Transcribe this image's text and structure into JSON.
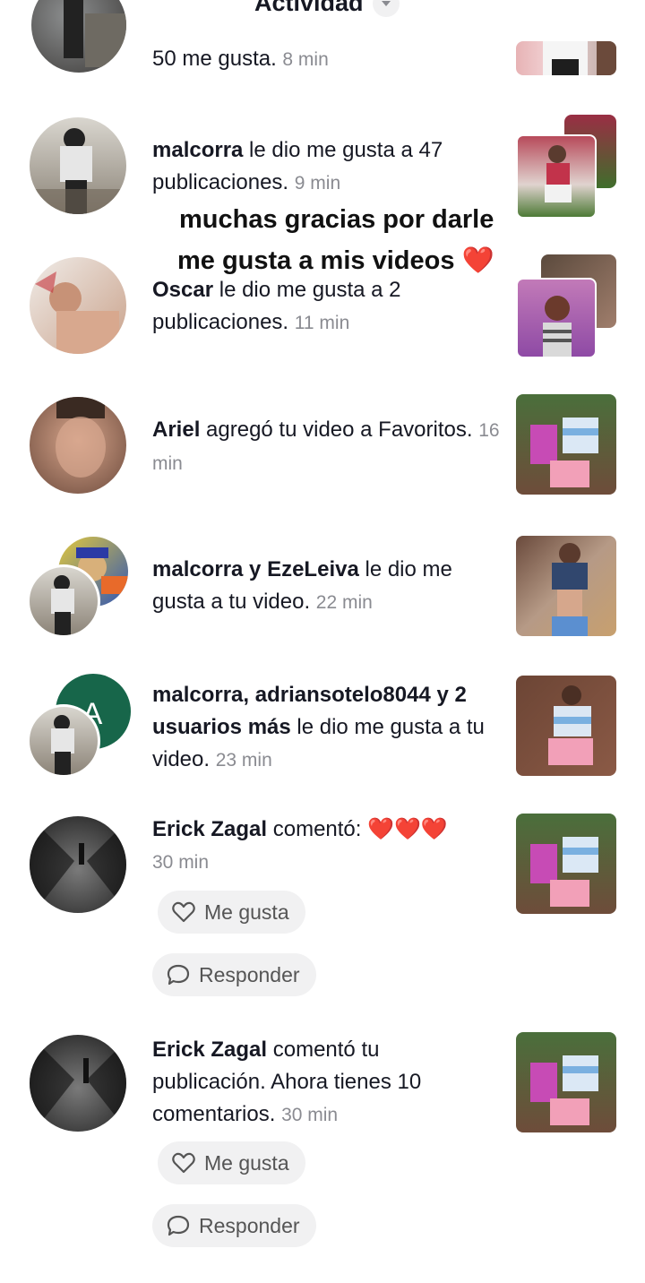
{
  "header": {
    "title": "Actividad"
  },
  "overlay": {
    "line1": "muchas gracias por darle",
    "line2": "me gusta a mis videos",
    "emoji": "❤️"
  },
  "rows": [
    {
      "text": "50 me gusta.",
      "time": "8 min"
    },
    {
      "name": "malcorra",
      "text": " le dio me gusta a 47 publicaciones.",
      "time": "9 min"
    },
    {
      "name": "Oscar",
      "text": " le dio me gusta a 2 publicaciones.",
      "time": "11 min"
    },
    {
      "name": "Ariel",
      "text": " agregó tu video a Favoritos.",
      "time": "16 min"
    },
    {
      "name": "malcorra y EzeLeiva",
      "text": " le dio me gusta a tu video.",
      "time": "22 min"
    },
    {
      "name": "malcorra, adriansotelo8044 y 2 usuarios más",
      "text": " le dio me gusta a tu video.",
      "time": "23 min",
      "avatar_letter": "A"
    },
    {
      "name": "Erick Zagal",
      "text": " comentó: ",
      "emoji": "❤️❤️❤️",
      "time": "30 min",
      "like_label": "Me gusta",
      "reply_label": "Responder"
    },
    {
      "name": "Erick Zagal",
      "text": " comentó tu publicación. Ahora tienes 10 comentarios.",
      "time": "30 min",
      "like_label": "Me gusta",
      "reply_label": "Responder"
    }
  ],
  "colors": {
    "accent": "#e8282a",
    "muted": "#8a8b91",
    "pill_bg": "#f1f1f2",
    "avatar_green": "#17664a"
  }
}
